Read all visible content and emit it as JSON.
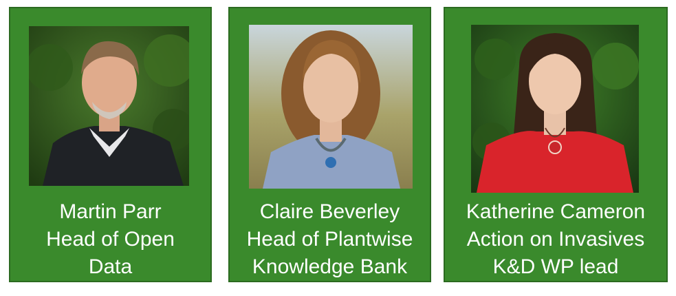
{
  "people": [
    {
      "name": "Martin Parr",
      "role_lines": [
        "Head of Open",
        "Data"
      ]
    },
    {
      "name": "Claire Beverley",
      "role_lines": [
        "Head of Plantwise",
        "Knowledge  Bank"
      ]
    },
    {
      "name": "Katherine Cameron",
      "role_lines": [
        "Action on Invasives",
        "K&D WP lead"
      ]
    }
  ],
  "colors": {
    "card": "#3a8a2c",
    "card_border": "#2b6a20",
    "text": "#ffffff"
  }
}
